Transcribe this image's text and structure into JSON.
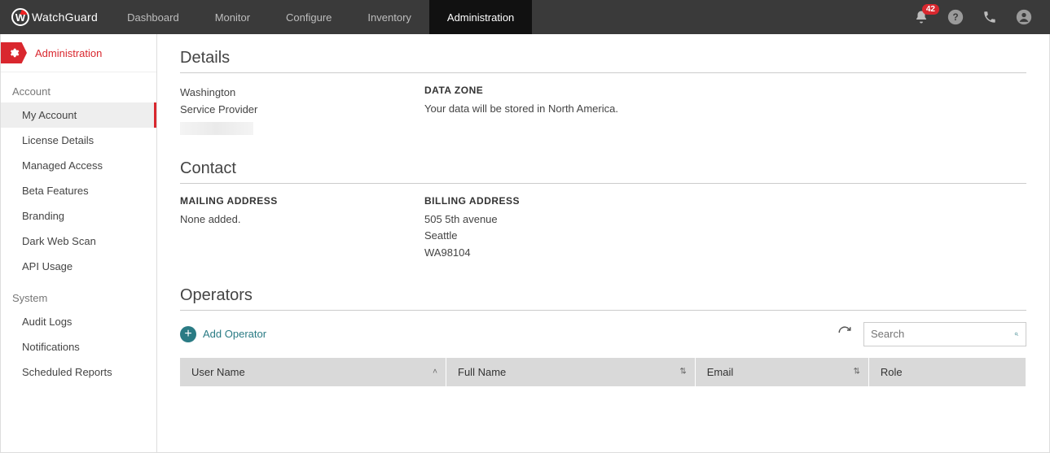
{
  "brand": "WatchGuard",
  "nav": {
    "items": [
      "Dashboard",
      "Monitor",
      "Configure",
      "Inventory",
      "Administration"
    ],
    "activeIndex": 4,
    "badgeCount": "42"
  },
  "sidebar": {
    "headerLabel": "Administration",
    "groups": [
      {
        "title": "Account",
        "items": [
          "My Account",
          "License Details",
          "Managed Access",
          "Beta Features",
          "Branding",
          "Dark Web Scan",
          "API Usage"
        ],
        "activeIndex": 0
      },
      {
        "title": "System",
        "items": [
          "Audit Logs",
          "Notifications",
          "Scheduled Reports"
        ],
        "activeIndex": -1
      }
    ]
  },
  "details": {
    "title": "Details",
    "accountName": "Washington",
    "accountType": "Service Provider",
    "dataZoneLabel": "DATA ZONE",
    "dataZoneText": "Your data will be stored in North America."
  },
  "contact": {
    "title": "Contact",
    "mailingLabel": "MAILING ADDRESS",
    "mailingValue": "None added.",
    "billingLabel": "BILLING ADDRESS",
    "billingLine1": "505 5th avenue",
    "billingLine2": "Seattle",
    "billingLine3": "WA98104"
  },
  "operators": {
    "title": "Operators",
    "addLabel": "Add Operator",
    "searchPlaceholder": "Search",
    "columns": [
      "User Name",
      "Full Name",
      "Email",
      "Role"
    ]
  }
}
